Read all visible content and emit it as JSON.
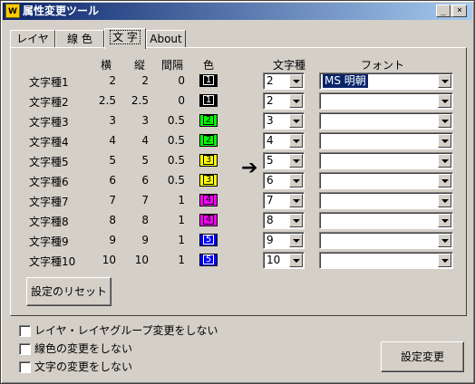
{
  "window": {
    "title": "属性変更ツール",
    "icon_text": "W",
    "controls": {
      "minimize": "_",
      "maximize": "□",
      "close": "×"
    }
  },
  "tabs": [
    "レイヤ",
    "線 色",
    "文 字",
    "About"
  ],
  "active_tab": "文 字",
  "table": {
    "headers": {
      "width": "横",
      "height": "縦",
      "spacing": "間隔",
      "color": "色",
      "target": "文字種",
      "font": "フォント"
    },
    "rows": [
      {
        "label": "文字種1",
        "width": "2",
        "height": "2",
        "spacing": "0",
        "color_num": "1",
        "color": "#000000",
        "num_color": "#ffffff",
        "target": "2",
        "font": "MS 明朝"
      },
      {
        "label": "文字種2",
        "width": "2.5",
        "height": "2.5",
        "spacing": "0",
        "color_num": "1",
        "color": "#000000",
        "num_color": "#ffffff",
        "target": "2",
        "font": ""
      },
      {
        "label": "文字種3",
        "width": "3",
        "height": "3",
        "spacing": "0.5",
        "color_num": "2",
        "color": "#00ff00",
        "num_color": "#000000",
        "target": "3",
        "font": ""
      },
      {
        "label": "文字種4",
        "width": "4",
        "height": "4",
        "spacing": "0.5",
        "color_num": "2",
        "color": "#00ff00",
        "num_color": "#000000",
        "target": "4",
        "font": ""
      },
      {
        "label": "文字種5",
        "width": "5",
        "height": "5",
        "spacing": "0.5",
        "color_num": "3",
        "color": "#ffff00",
        "num_color": "#000000",
        "target": "5",
        "font": ""
      },
      {
        "label": "文字種6",
        "width": "6",
        "height": "6",
        "spacing": "0.5",
        "color_num": "3",
        "color": "#ffff00",
        "num_color": "#000000",
        "target": "6",
        "font": ""
      },
      {
        "label": "文字種7",
        "width": "7",
        "height": "7",
        "spacing": "1",
        "color_num": "4",
        "color": "#ff00ff",
        "num_color": "#000000",
        "target": "7",
        "font": ""
      },
      {
        "label": "文字種8",
        "width": "8",
        "height": "8",
        "spacing": "1",
        "color_num": "4",
        "color": "#ff00ff",
        "num_color": "#000000",
        "target": "8",
        "font": ""
      },
      {
        "label": "文字種9",
        "width": "9",
        "height": "9",
        "spacing": "1",
        "color_num": "5",
        "color": "#0000ff",
        "num_color": "#ffffff",
        "target": "9",
        "font": ""
      },
      {
        "label": "文字種10",
        "width": "10",
        "height": "10",
        "spacing": "1",
        "color_num": "5",
        "color": "#0000ff",
        "num_color": "#ffffff",
        "target": "10",
        "font": ""
      }
    ],
    "arrow": "➔"
  },
  "reset_button": "設定のリセット",
  "checkboxes": [
    {
      "label": "レイヤ・レイヤグループ変更をしない",
      "checked": false
    },
    {
      "label": "線色の変更をしない",
      "checked": false
    },
    {
      "label": "文字の変更をしない",
      "checked": false
    }
  ],
  "apply_button": "設定変更"
}
